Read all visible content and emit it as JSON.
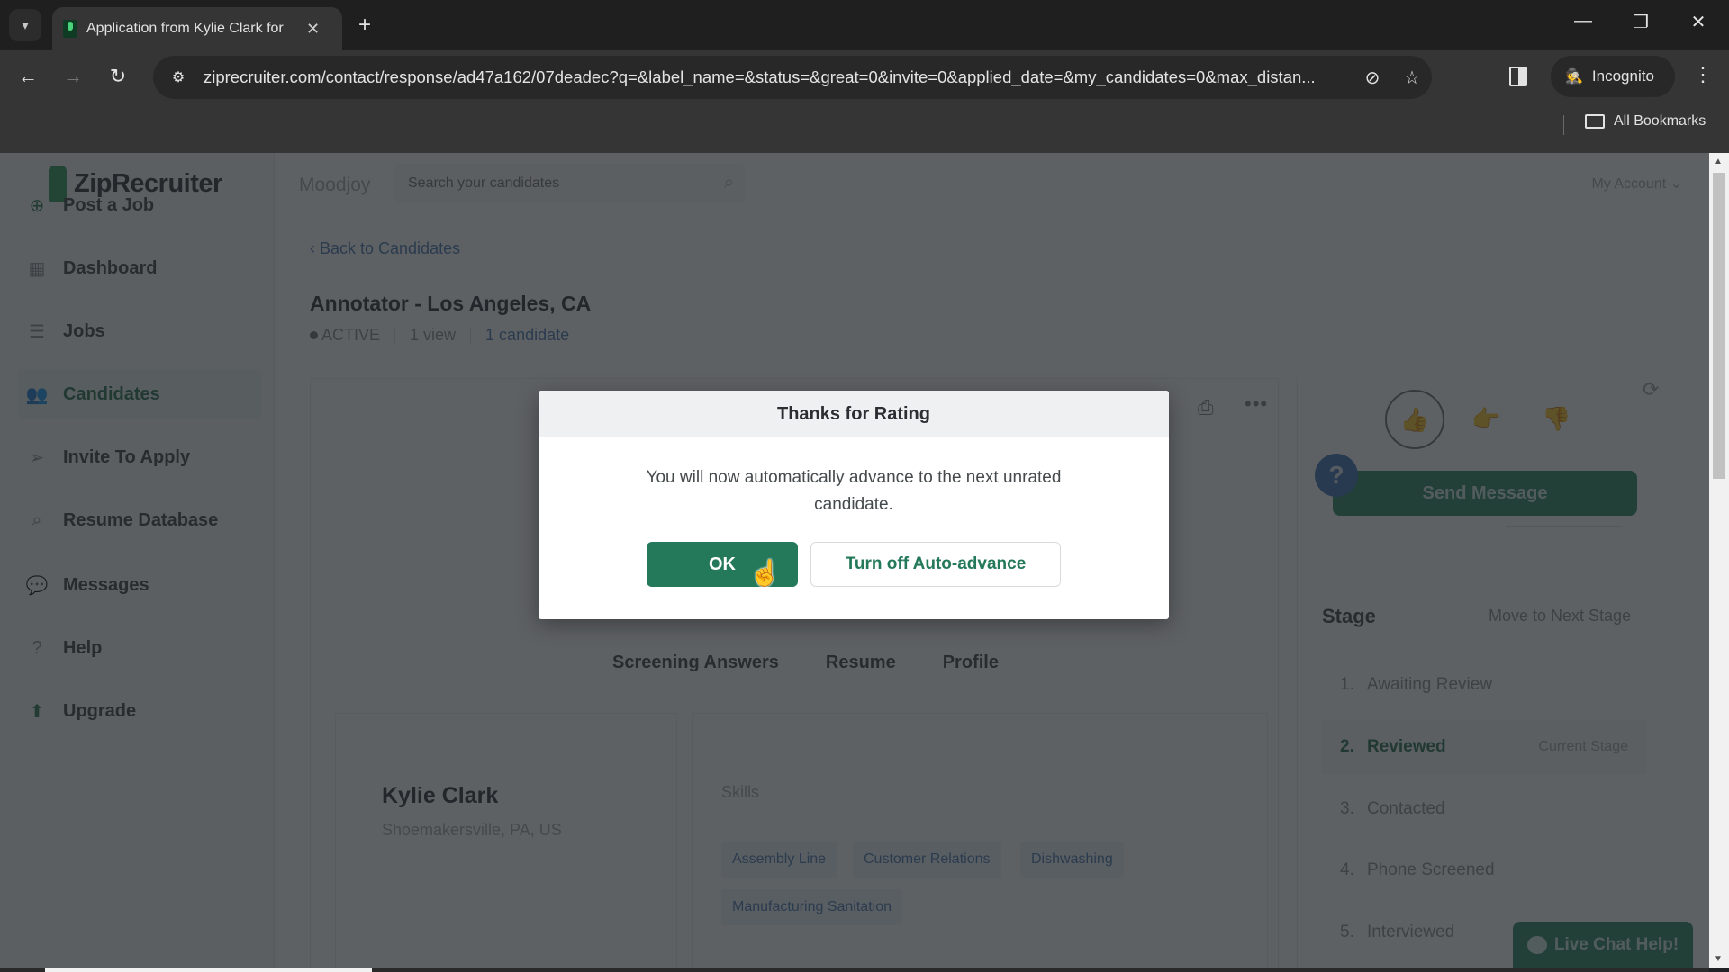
{
  "browser": {
    "tab_title": "Application from Kylie Clark for",
    "url": "ziprecruiter.com/contact/response/ad47a162/07deadec?q=&label_name=&status=&great=0&invite=0&applied_date=&my_candidates=0&max_distan...",
    "incognito_label": "Incognito",
    "all_bookmarks_label": "All Bookmarks",
    "icons": {
      "tab_search": "▾",
      "close": "✕",
      "new_tab": "+",
      "minimize": "—",
      "restore": "❐",
      "window_close": "✕",
      "back": "←",
      "forward": "→",
      "reload": "↻",
      "site_info": "⚙",
      "eye_off": "⊘",
      "star": "☆",
      "incognito": "🕵",
      "more": "⋮"
    }
  },
  "app": {
    "logo_text": "ZipRecruiter",
    "company": "Moodjoy",
    "search_placeholder": "Search your candidates",
    "account_label": "My Account ⌄",
    "sidebar": [
      {
        "label": "Post a Job",
        "icon": "⊕"
      },
      {
        "label": "Dashboard",
        "icon": "▦"
      },
      {
        "label": "Jobs",
        "icon": "☰"
      },
      {
        "label": "Candidates",
        "icon": "👥",
        "active": true
      },
      {
        "label": "Invite To Apply",
        "icon": "➢"
      },
      {
        "label": "Resume Database",
        "icon": "⌕"
      },
      {
        "label": "Messages",
        "icon": "💬"
      },
      {
        "label": "Help",
        "icon": "?"
      },
      {
        "label": "Upgrade",
        "icon": "⬆"
      }
    ],
    "back_link": "‹ Back to Candidates",
    "job": {
      "title": "Annotator - Los Angeles, CA",
      "status": "ACTIVE",
      "views": "1 view",
      "candidates": "1 candidate"
    },
    "detail_tabs": [
      "Screening Answers",
      "Resume",
      "Profile"
    ],
    "candidate": {
      "name": "Kylie Clark",
      "location": "Shoemakersville, PA, US"
    },
    "skills_label": "Skills",
    "skills": [
      "Assembly Line",
      "Customer Relations",
      "Dishwashing",
      "Manufacturing Sanitation"
    ],
    "send_message_label": "Send Message",
    "help_bubble": "?",
    "stage": {
      "title": "Stage",
      "move_next": "Move to Next Stage",
      "current_label": "Current Stage",
      "items": [
        {
          "num": "1.",
          "label": "Awaiting Review"
        },
        {
          "num": "2.",
          "label": "Reviewed",
          "current": true
        },
        {
          "num": "3.",
          "label": "Contacted"
        },
        {
          "num": "4.",
          "label": "Phone Screened"
        },
        {
          "num": "5.",
          "label": "Interviewed"
        }
      ]
    },
    "live_chat_label": "Live Chat Help!"
  },
  "modal": {
    "title": "Thanks for Rating",
    "message": "You will now automatically advance to the next unrated candidate.",
    "ok_label": "OK",
    "turn_off_label": "Turn off Auto-advance"
  }
}
